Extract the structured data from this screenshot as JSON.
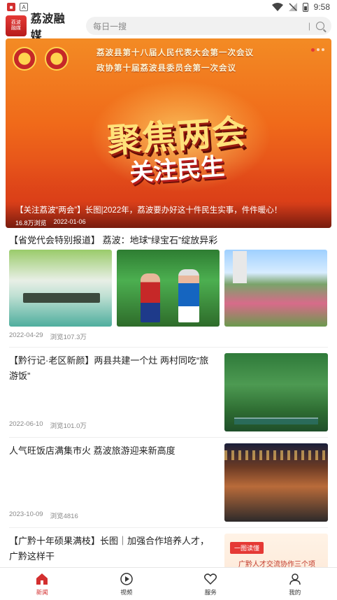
{
  "status_bar": {
    "time": "9:58"
  },
  "header": {
    "logo_text_top": "荔波",
    "logo_text_bottom": "融媒",
    "app_title": "荔波融媒",
    "search_placeholder": "每日一搜"
  },
  "banner": {
    "line1": "荔波县第十八届人民代表大会第一次会议",
    "line2": "政协第十届荔波县委员会第一次会议",
    "main_text": "聚焦两会",
    "sub_text": "关注民生",
    "title": "【关注荔波“两会”】长图|2022年，荔波要办好这十件民生实事，件件暖心！",
    "views": "16.8万浏览",
    "date": "2022-01-06"
  },
  "news": [
    {
      "title": "【省党代会特别报道】 荔波：地球“绿宝石”绽放异彩",
      "date": "2022-04-29",
      "views": "浏览107.3万"
    },
    {
      "title": "【黔行记·老区新颜】两县共建一个灶 两村同吃“旅游饭”",
      "date": "2022-06-10",
      "views": "浏览101.0万"
    },
    {
      "title": "人气旺饭店满集市火 荔波旅游迎来新高度",
      "date": "2023-10-09",
      "views": "浏览4816"
    },
    {
      "title": "【广黔十年硕果满枝】长图｜加强合作培养人才，广黔这样干",
      "badge": "一图读懂",
      "image_text": "广黔人才交流协作三个项目"
    }
  ],
  "tabbar": [
    {
      "label": "新闻",
      "icon": "home-icon",
      "active": true
    },
    {
      "label": "视频",
      "icon": "play-icon",
      "active": false
    },
    {
      "label": "服务",
      "icon": "heart-icon",
      "active": false
    },
    {
      "label": "我的",
      "icon": "user-icon",
      "active": false
    }
  ],
  "colors": {
    "accent": "#d32f2f"
  }
}
